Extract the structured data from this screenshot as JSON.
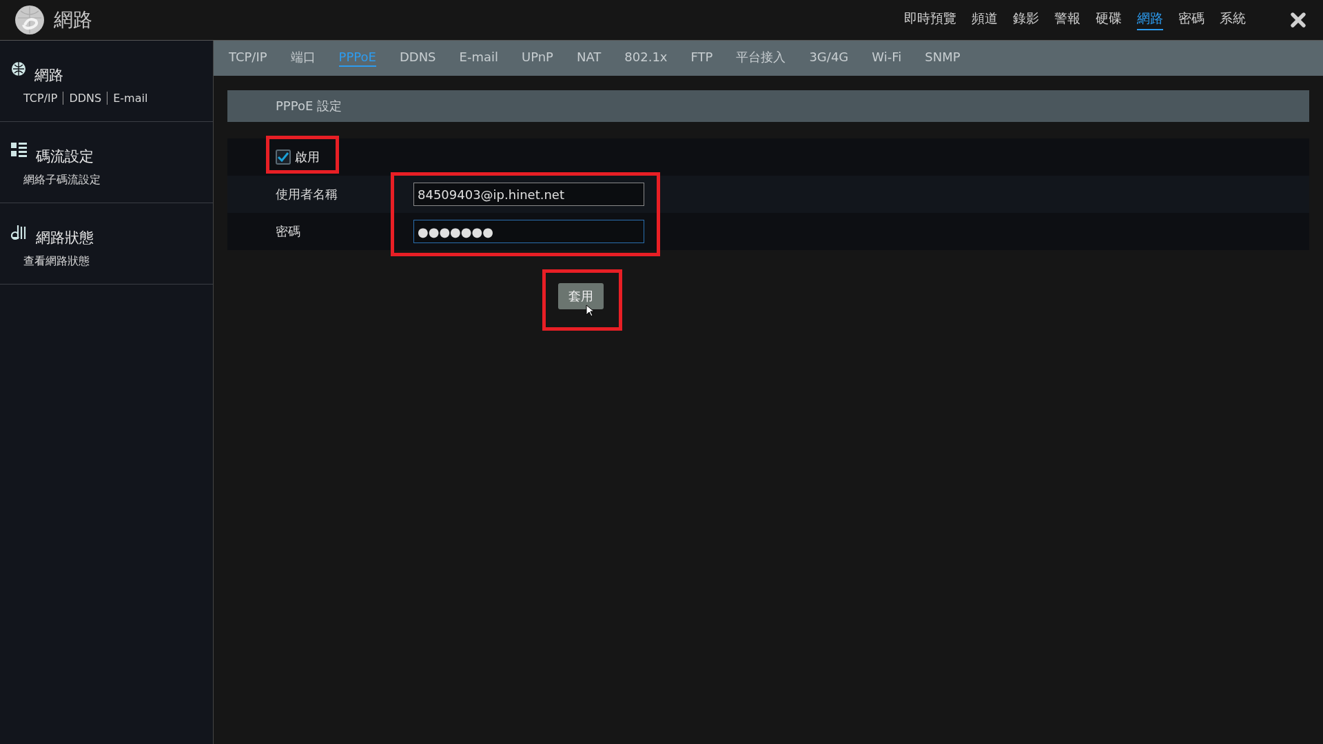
{
  "app": {
    "title": "網路"
  },
  "top_nav": [
    {
      "label": "即時預覽",
      "selected": false
    },
    {
      "label": "頻道",
      "selected": false
    },
    {
      "label": "錄影",
      "selected": false
    },
    {
      "label": "警報",
      "selected": false
    },
    {
      "label": "硬碟",
      "selected": false
    },
    {
      "label": "網路",
      "selected": true
    },
    {
      "label": "密碼",
      "selected": false
    },
    {
      "label": "系統",
      "selected": false
    }
  ],
  "sidebar": {
    "items": [
      {
        "kind": "network",
        "title": "網路",
        "links": [
          "TCP/IP",
          "DDNS",
          "E-mail"
        ]
      },
      {
        "kind": "stream",
        "title": "碼流設定",
        "subtitle": "網絡子碼流設定"
      },
      {
        "kind": "status",
        "title": "網路狀態",
        "subtitle": "查看網路狀態"
      }
    ]
  },
  "tabs": [
    {
      "label": "TCP/IP",
      "selected": false
    },
    {
      "label": "端口",
      "selected": false
    },
    {
      "label": "PPPoE",
      "selected": true
    },
    {
      "label": "DDNS",
      "selected": false
    },
    {
      "label": "E-mail",
      "selected": false
    },
    {
      "label": "UPnP",
      "selected": false
    },
    {
      "label": "NAT",
      "selected": false
    },
    {
      "label": "802.1x",
      "selected": false
    },
    {
      "label": "FTP",
      "selected": false
    },
    {
      "label": "平台接入",
      "selected": false
    },
    {
      "label": "3G/4G",
      "selected": false
    },
    {
      "label": "Wi-Fi",
      "selected": false
    },
    {
      "label": "SNMP",
      "selected": false
    }
  ],
  "section": {
    "title": "PPPoE 設定"
  },
  "enable": {
    "label": "啟用",
    "checked": true
  },
  "fields": [
    {
      "label": "使用者名稱",
      "value": "84509403@ip.hinet.net",
      "focused": false
    },
    {
      "label": "密碼",
      "value": "●●●●●●●",
      "focused": true
    }
  ],
  "apply_button": "套用"
}
